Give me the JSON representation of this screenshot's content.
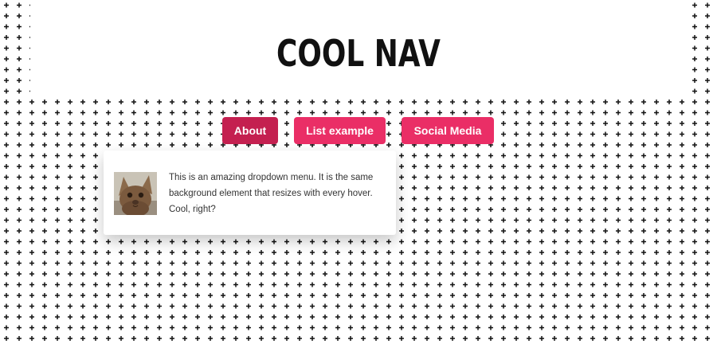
{
  "header": {
    "title": "COOL NAV"
  },
  "nav": {
    "items": [
      {
        "label": "About",
        "active": true
      },
      {
        "label": "List example",
        "active": false
      },
      {
        "label": "Social Media",
        "active": false
      }
    ]
  },
  "dropdown": {
    "description": "This is an amazing dropdown menu. It is the same background element that resizes with every hover. Cool, right?",
    "image_icon": "cat-photo"
  },
  "colors": {
    "accent": "#ea2e66",
    "accent_active": "#c42050",
    "pattern": "#111111",
    "background": "#ffffff"
  },
  "pattern_icon": "plus-sign-pattern"
}
